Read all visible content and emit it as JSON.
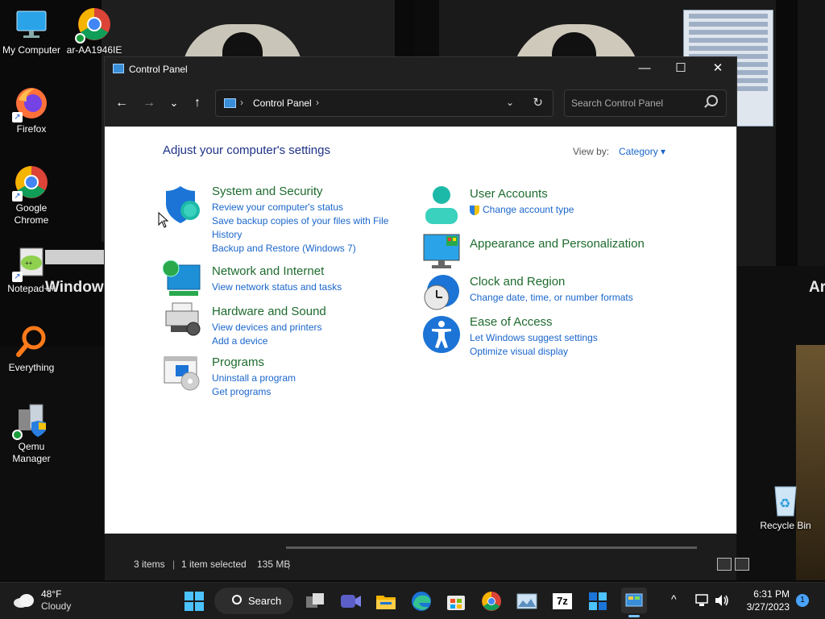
{
  "desktop": {
    "icons": [
      {
        "label": "My Computer"
      },
      {
        "label": "ar-AA1946IE"
      },
      {
        "label": "Firefox"
      },
      {
        "label": "Google Chrome"
      },
      {
        "label": "Notepad++"
      },
      {
        "label": "Everything"
      },
      {
        "label": "Qemu Manager"
      },
      {
        "label": "Recycle Bin"
      }
    ],
    "background_texts": [
      "Window",
      "Ar"
    ]
  },
  "window": {
    "title": "Control Panel",
    "controls": {
      "minimize": "—",
      "maximize": "☐",
      "close": "✕"
    },
    "nav": {
      "back": "←",
      "forward": "→",
      "recent": "⌄",
      "up": "↑"
    },
    "address": {
      "separator": "›",
      "location": "Control Panel",
      "dropdown": "⌄",
      "refresh": "↻"
    },
    "search": {
      "placeholder": "Search Control Panel"
    },
    "heading": "Adjust your computer's settings",
    "view_by": {
      "label": "View by:",
      "value": "Category ▾"
    },
    "categories": [
      {
        "title": "System and Security",
        "icon": "shield-icon",
        "links": [
          "Review your computer's status",
          "Save backup copies of your files with File History",
          "Backup and Restore (Windows 7)"
        ]
      },
      {
        "title": "Network and Internet",
        "icon": "globe-network-icon",
        "links": [
          "View network status and tasks"
        ]
      },
      {
        "title": "Hardware and Sound",
        "icon": "printer-icon",
        "links": [
          "View devices and printers",
          "Add a device"
        ]
      },
      {
        "title": "Programs",
        "icon": "programs-icon",
        "links": [
          "Uninstall a program",
          "Get programs"
        ]
      },
      {
        "title": "User Accounts",
        "icon": "user-icon",
        "links": [
          "Change account type"
        ]
      },
      {
        "title": "Appearance and Personalization",
        "icon": "monitor-icon",
        "links": []
      },
      {
        "title": "Clock and Region",
        "icon": "clock-globe-icon",
        "links": [
          "Change date, time, or number formats"
        ]
      },
      {
        "title": "Ease of Access",
        "icon": "accessibility-icon",
        "links": [
          "Let Windows suggest settings",
          "Optimize visual display"
        ]
      }
    ]
  },
  "statusbar": {
    "items": "3 items",
    "selected": "1 item selected",
    "size": "135 MB",
    "sep": "|"
  },
  "taskbar": {
    "weather": {
      "temp": "48°F",
      "condition": "Cloudy"
    },
    "search_label": "Search",
    "apps": [
      "windows-start-icon",
      "task-view-icon",
      "meet-icon",
      "file-explorer-icon",
      "edge-icon",
      "store-icon",
      "chrome-icon",
      "photos-icon",
      "7zip-icon",
      "control-panel-icon"
    ],
    "sevenzip_label": "7z",
    "tray": {
      "chevron": "^",
      "time": "6:31 PM",
      "date": "3/27/2023",
      "notifications": "1"
    }
  },
  "colors": {
    "titlebar": "#202020",
    "heading": "#1e3287",
    "category_title": "#1e6b2e",
    "link": "#1a66cc"
  }
}
